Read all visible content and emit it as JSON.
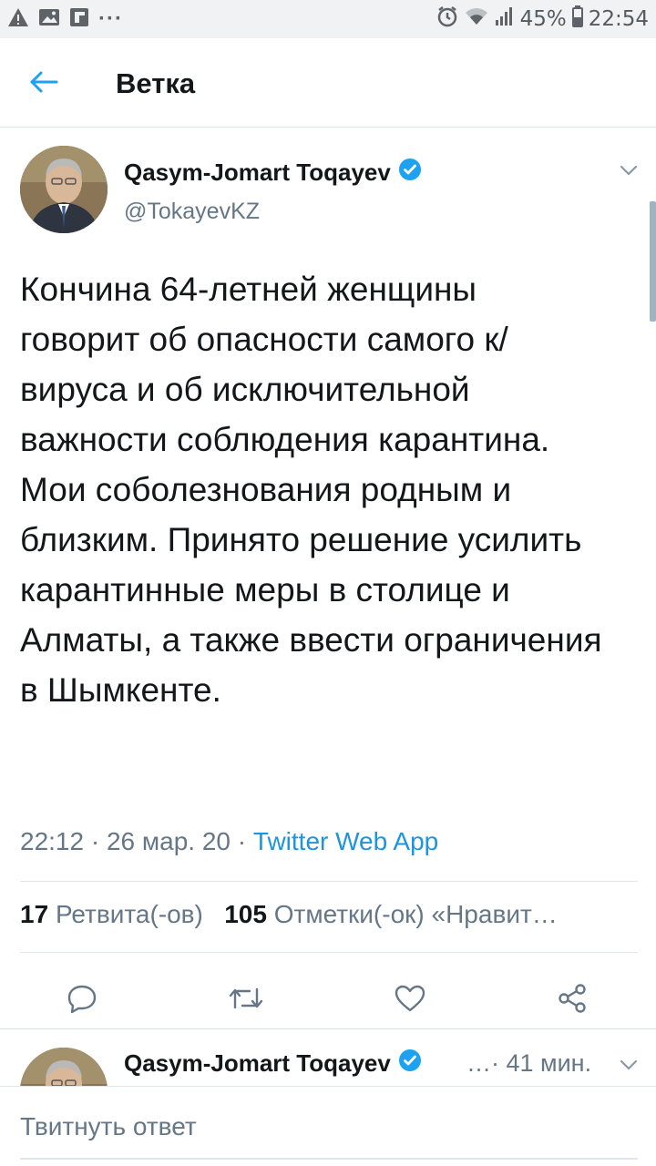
{
  "status_bar": {
    "left_icons": [
      "warning-icon",
      "image-icon",
      "flipboard-icon",
      "more-dots-icon"
    ],
    "more_dots": "···",
    "battery": "45%",
    "time": "22:54",
    "right_icons": [
      "alarm-icon",
      "wifi-icon",
      "signal-icon",
      "battery-icon"
    ]
  },
  "header": {
    "title": "Ветка",
    "back_icon": "arrow-left-icon",
    "accent": "#1da1f2"
  },
  "tweet": {
    "author_name": "Qasym-Jomart Toqayev",
    "verified_icon": "verified-badge-icon",
    "handle": "@TokayevKZ",
    "text": "Кончина 64-летней женщины говорит об опасности самого к/вируса и об исключительной важности соблюдения карантина. Мои соболезнования родным и близким. Принято решение усилить карантинные меры в столице и Алматы, а также ввести ограничения в Шымкенте.",
    "time": "22:12",
    "date": "26 мар. 20",
    "source": "Twitter Web App",
    "retweets_count": "17",
    "retweets_label": "Ретвита(-ов)",
    "likes_count": "105",
    "likes_label": "Отметки(-ок) «Нравит…",
    "actions": [
      "reply-icon",
      "retweet-icon",
      "like-icon",
      "share-icon"
    ]
  },
  "next_tweet": {
    "author_name": "Qasym-Jomart Toqayev",
    "ellipsis": "…",
    "time_ago": "· 41 мин."
  },
  "reply": {
    "placeholder": "Твитнуть ответ"
  }
}
